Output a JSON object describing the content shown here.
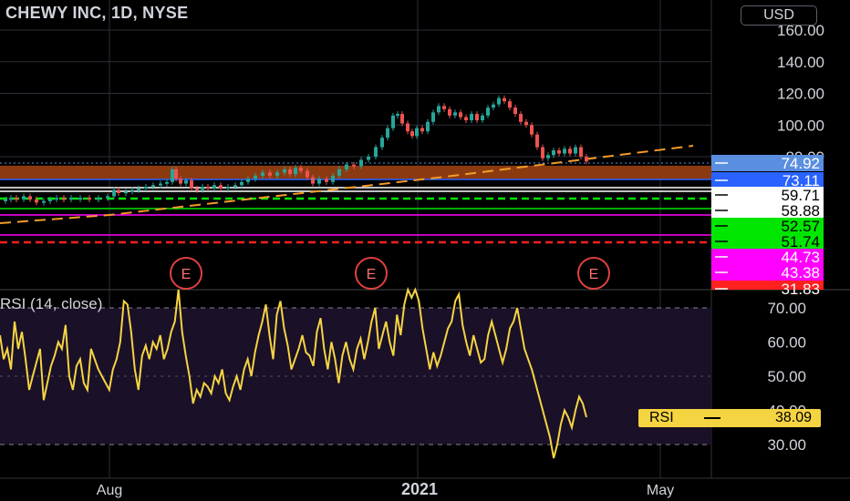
{
  "header": {
    "title": "CHEWY INC, 1D, NYSE",
    "currency": "USD"
  },
  "colors": {
    "background": "#000000",
    "grid": "#2a2e39",
    "candle_up": "#26a69a",
    "candle_down": "#ef5350",
    "rsi_line": "#f5d442",
    "rsi_band": "#1a1028",
    "trend_orange": "#f59b2a",
    "level_brown": "#8b3a10"
  },
  "chart_data": [
    {
      "type": "candlestick",
      "title": "CHEWY INC, 1D, NYSE",
      "price_axis_ticks": [
        160,
        140,
        120,
        100,
        80
      ],
      "price_axis_labels": [
        "160.00",
        "140.00",
        "120.00",
        "100.00",
        "80.00"
      ],
      "ylim": [
        20,
        168
      ],
      "time_axis_labels": [
        "Aug",
        "2021",
        "May"
      ],
      "price_path": [
        [
          0,
          52
        ],
        [
          6,
          53
        ],
        [
          12,
          54
        ],
        [
          18,
          53
        ],
        [
          26,
          55
        ],
        [
          33,
          53
        ],
        [
          40,
          51
        ],
        [
          48,
          52
        ],
        [
          55,
          53
        ],
        [
          62,
          54
        ],
        [
          70,
          53
        ],
        [
          78,
          54
        ],
        [
          88,
          54
        ],
        [
          98,
          53
        ],
        [
          108,
          54
        ],
        [
          118,
          55
        ],
        [
          125,
          59
        ],
        [
          130,
          57
        ],
        [
          138,
          58
        ],
        [
          145,
          59
        ],
        [
          152,
          60
        ],
        [
          160,
          61
        ],
        [
          168,
          62
        ],
        [
          176,
          63
        ],
        [
          183,
          64
        ],
        [
          189,
          72
        ],
        [
          193,
          66
        ],
        [
          198,
          63
        ],
        [
          204,
          65
        ],
        [
          210,
          60
        ],
        [
          216,
          59
        ],
        [
          222,
          61
        ],
        [
          228,
          60
        ],
        [
          235,
          62
        ],
        [
          242,
          60
        ],
        [
          250,
          61
        ],
        [
          258,
          62
        ],
        [
          265,
          64
        ],
        [
          272,
          66
        ],
        [
          280,
          68
        ],
        [
          288,
          70
        ],
        [
          296,
          68
        ],
        [
          304,
          70
        ],
        [
          312,
          72
        ],
        [
          318,
          69
        ],
        [
          324,
          73
        ],
        [
          330,
          71
        ],
        [
          337,
          67
        ],
        [
          343,
          63
        ],
        [
          350,
          66
        ],
        [
          358,
          64
        ],
        [
          365,
          68
        ],
        [
          372,
          72
        ],
        [
          380,
          75
        ],
        [
          388,
          74
        ],
        [
          396,
          78
        ],
        [
          404,
          80
        ],
        [
          412,
          86
        ],
        [
          419,
          92
        ],
        [
          425,
          98
        ],
        [
          431,
          106
        ],
        [
          436,
          107
        ],
        [
          441,
          101
        ],
        [
          447,
          96
        ],
        [
          452,
          93
        ],
        [
          457,
          98
        ],
        [
          463,
          96
        ],
        [
          469,
          102
        ],
        [
          475,
          108
        ],
        [
          481,
          112
        ],
        [
          487,
          110
        ],
        [
          493,
          106
        ],
        [
          499,
          108
        ],
        [
          505,
          105
        ],
        [
          511,
          103
        ],
        [
          517,
          107
        ],
        [
          523,
          103
        ],
        [
          529,
          106
        ],
        [
          535,
          111
        ],
        [
          541,
          113
        ],
        [
          547,
          117
        ],
        [
          553,
          115
        ],
        [
          559,
          111
        ],
        [
          565,
          107
        ],
        [
          571,
          102
        ],
        [
          577,
          100
        ],
        [
          583,
          94
        ],
        [
          589,
          86
        ],
        [
          595,
          79
        ],
        [
          601,
          81
        ],
        [
          607,
          84
        ],
        [
          613,
          82
        ],
        [
          619,
          85
        ],
        [
          625,
          82
        ],
        [
          631,
          86
        ],
        [
          637,
          80
        ],
        [
          643,
          77
        ]
      ],
      "price_levels": [
        {
          "price": 74.92,
          "label": "74.92",
          "color": "#5a8fe0",
          "style": "dotted"
        },
        {
          "price": 73.11,
          "label": "73.11",
          "color": "#2962ff",
          "style": "solid"
        },
        {
          "price": 59.71,
          "label": "59.71",
          "color": "#ffffff",
          "style": "solid"
        },
        {
          "price": 58.88,
          "label": "58.88",
          "color": "#ffffff",
          "style": "solid"
        },
        {
          "price": 52.57,
          "label": "52.57",
          "color": "#00e600",
          "style": "dashed"
        },
        {
          "price": 51.74,
          "label": "51.74",
          "color": "#00e600",
          "style": "solid"
        },
        {
          "price": 44.73,
          "label": "44.73",
          "color": "#ff00ff",
          "style": "solid"
        },
        {
          "price": 43.38,
          "label": "43.38",
          "color": "#ff00ff",
          "style": "solid"
        },
        {
          "price": 31.83,
          "label": "31.83",
          "color": "#ff2020",
          "style": "dashed"
        }
      ],
      "resistance_bands": [
        72,
        68
      ],
      "trend_line": [
        [
          0,
          38
        ],
        [
          120,
          46
        ],
        [
          480,
          67
        ],
        [
          760,
          87
        ]
      ],
      "event_markers": [
        "E",
        "E",
        "E"
      ]
    },
    {
      "type": "line",
      "title": "RSI (14, close)",
      "series": [
        {
          "name": "RSI",
          "values": [
            62,
            55,
            58,
            52,
            66,
            58,
            63,
            55,
            46,
            50,
            54,
            58,
            43,
            48,
            53,
            56,
            60,
            58,
            65,
            50,
            46,
            53,
            55,
            48,
            46,
            58,
            55,
            52,
            50,
            48,
            46,
            52,
            55,
            60,
            72,
            71,
            63,
            52,
            46,
            56,
            59,
            55,
            60,
            58,
            62,
            55,
            58,
            63,
            66,
            78,
            63,
            56,
            50,
            42,
            46,
            44,
            48,
            47,
            45,
            50,
            48,
            52,
            45,
            43,
            47,
            50,
            46,
            52,
            55,
            50,
            57,
            62,
            66,
            71,
            62,
            55,
            68,
            72,
            64,
            59,
            52,
            55,
            58,
            62,
            57,
            56,
            53,
            63,
            67,
            58,
            52,
            60,
            55,
            48,
            56,
            60,
            55,
            52,
            58,
            61,
            55,
            60,
            66,
            70,
            58,
            62,
            66,
            60,
            56,
            68,
            62,
            71,
            78,
            73,
            77,
            72,
            64,
            58,
            52,
            57,
            53,
            56,
            60,
            64,
            66,
            72,
            74,
            65,
            60,
            56,
            62,
            58,
            54,
            55,
            62,
            66,
            62,
            58,
            54,
            58,
            64,
            66,
            70,
            64,
            58,
            55,
            52,
            48,
            44,
            40,
            36,
            32,
            26,
            30,
            36,
            40,
            38,
            35,
            40,
            44,
            42,
            38
          ]
        }
      ],
      "ylim": [
        22,
        79
      ],
      "axis_ticks": [
        70,
        60,
        50,
        40,
        30
      ],
      "axis_labels": [
        "70.00",
        "60.00",
        "50.00",
        "40.00",
        "30.00"
      ],
      "last_value": {
        "label": "RSI",
        "value": "38.09"
      }
    }
  ],
  "rsi_title": "RSI (14, close)"
}
